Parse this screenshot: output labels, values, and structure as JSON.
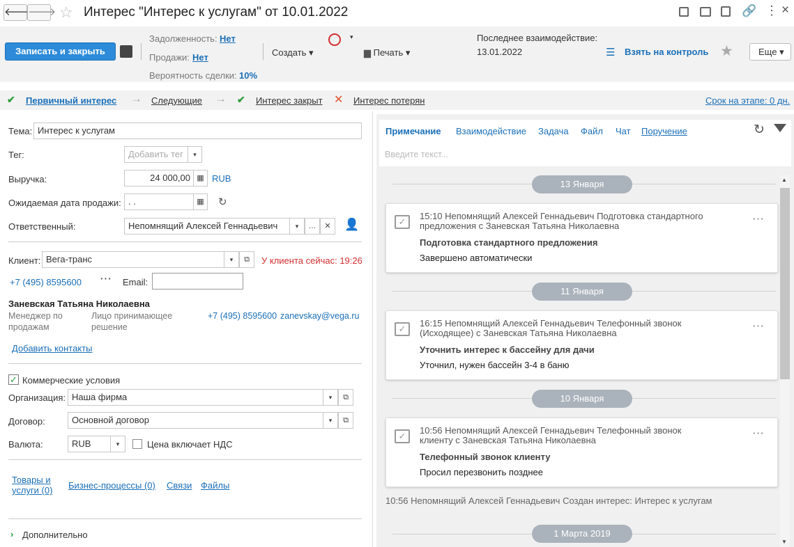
{
  "window": {
    "title": "Интерес \"Интерес к услугам\" от 10.01.2022"
  },
  "toolbar": {
    "save_close": "Записать и закрыть",
    "debt_label": "Задолженность:",
    "debt_value": "Нет",
    "sales_label": "Продажи:",
    "sales_value": "Нет",
    "prob_label": "Вероятность сделки:",
    "prob_value": "10%",
    "create": "Создать",
    "print": "Печать",
    "last_label": "Последнее взаимодействие:",
    "last_value": "13.01.2022",
    "control": "Взять на контроль",
    "more": "Еще"
  },
  "stages": {
    "s1": "Первичный интерес",
    "s2": "Следующие",
    "s3": "Интерес закрыт",
    "s4": "Интерес потерян",
    "term": "Срок на этапе: 0 дн."
  },
  "form": {
    "theme_label": "Тема:",
    "theme_value": "Интерес к услугам",
    "tag_label": "Тег:",
    "tag_placeholder": "Добавить тег",
    "revenue_label": "Выручка:",
    "revenue_value": "24 000,00",
    "currency": "RUB",
    "date_label": "Ожидаемая дата продажи:",
    "date_value": ". .",
    "resp_label": "Ответственный:",
    "resp_value": "Непомнящий Алексей Геннадьевич",
    "client_label": "Клиент:",
    "client_value": "Вега-транс",
    "client_time": "У клиента сейчас: 19:26",
    "phone": "+7 (495) 8595600",
    "email_label": "Email:",
    "contact_name": "Заневская Татьяна Николаевна",
    "contact_role1": "Менеджер по продажам",
    "contact_role2": "Лицо принимающее решение",
    "contact_phone": "+7 (495) 8595600",
    "contact_email": "zanevskay@vega.ru",
    "add_contacts": "Добавить контакты",
    "commercial": "Коммерческие условия",
    "org_label": "Организация:",
    "org_value": "Наша фирма",
    "contract_label": "Договор:",
    "contract_value": "Основной договор",
    "currency_label": "Валюта:",
    "currency_value": "RUB",
    "vat": "Цена включает НДС",
    "link1": "Товары и услуги (0)",
    "link2": "Бизнес-процессы (0)",
    "link3": "Связи",
    "link4": "Файлы",
    "extra": "Дополнительно"
  },
  "panel": {
    "tabs": [
      "Примечание",
      "Взаимодействие",
      "Задача",
      "Файл",
      "Чат",
      "Поручение"
    ],
    "input_placeholder": "Введите текст...",
    "dates": [
      "13 Января",
      "11 Января",
      "10 Января",
      "1 Марта 2019"
    ],
    "cards": [
      {
        "head": "15:10 Непомнящий Алексей Геннадьевич Подготовка стандартного предложения с Заневская Татьяна Николаевна",
        "title": "Подготовка стандартного предложения",
        "body": "Завершено автоматически"
      },
      {
        "head": "16:15 Непомнящий Алексей Геннадьевич Телефонный звонок (Исходящее) с Заневская Татьяна Николаевна",
        "title": "Уточнить интерес к бассейну для дачи",
        "body": "Уточнил, нужен бассейн 3-4 в баню"
      },
      {
        "head": "10:56 Непомнящий Алексей Геннадьевич Телефонный звонок клиенту с Заневская Татьяна Николаевна",
        "title": "Телефонный звонок клиенту",
        "body": "Просил перезвонить позднее"
      }
    ],
    "plain": "10:56 Непомнящий Алексей Геннадьевич Создан интерес: Интерес к услугам"
  },
  "colors": {
    "accent": "#1a6fb8",
    "primary_btn": "#2d8bd9",
    "danger": "#d32f2f",
    "green": "#2e9e3e"
  }
}
